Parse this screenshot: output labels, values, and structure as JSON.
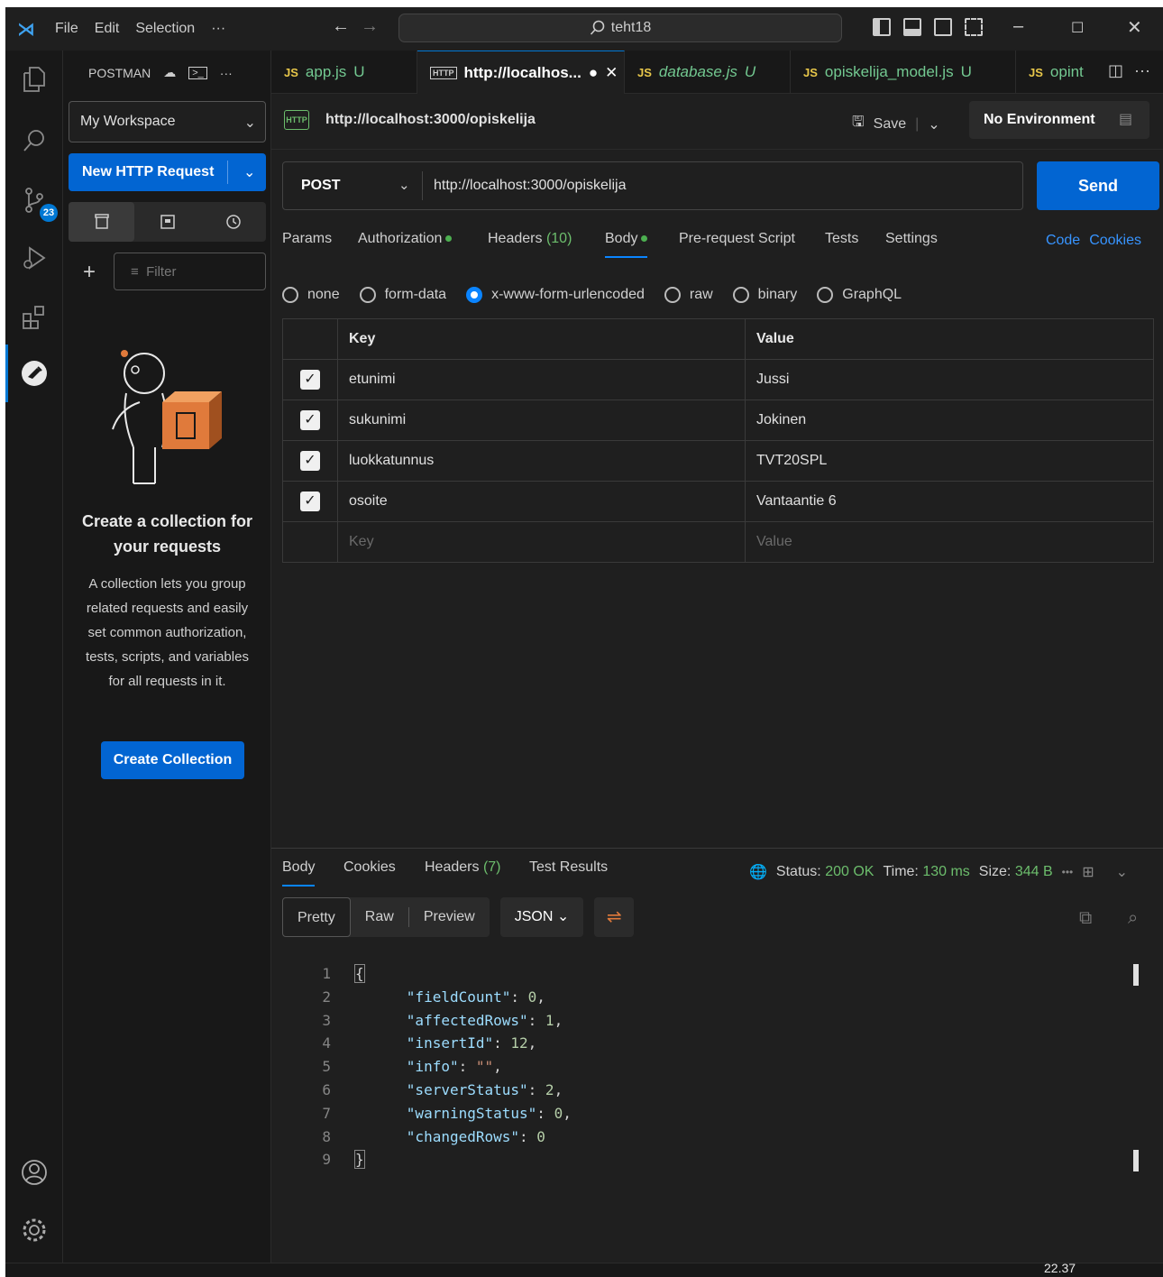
{
  "titlebar": {
    "menu": [
      "File",
      "Edit",
      "Selection",
      "···"
    ],
    "search_text": "teht18"
  },
  "activity": {
    "scm_badge": "23"
  },
  "sidebar": {
    "header": "POSTMAN",
    "workspace": "My Workspace",
    "new_request": "New HTTP Request",
    "filter_placeholder": "Filter",
    "empty_title": "Create a collection for your requests",
    "empty_desc": "A collection lets you group related requests and easily set common authorization, tests, scripts, and variables for all requests in it.",
    "create_button": "Create Collection"
  },
  "tabs": [
    {
      "icon": "JS",
      "label": "app.js",
      "status": "U"
    },
    {
      "icon": "HTTP",
      "label": "http://localhos...",
      "status": "●"
    },
    {
      "icon": "JS",
      "label": "database.js",
      "status": "U"
    },
    {
      "icon": "JS",
      "label": "opiskelija_model.js",
      "status": "U"
    },
    {
      "icon": "JS",
      "label": "opint",
      "status": ""
    }
  ],
  "request": {
    "title": "http://localhost:3000/opiskelija",
    "save": "Save",
    "environment": "No Environment",
    "method": "POST",
    "url": "http://localhost:3000/opiskelija",
    "send": "Send"
  },
  "request_tabs": {
    "params": "Params",
    "authorization": "Authorization",
    "headers": "Headers",
    "headers_count": "(10)",
    "body": "Body",
    "prerequest": "Pre-request Script",
    "tests": "Tests",
    "settings": "Settings",
    "code": "Code",
    "cookies": "Cookies"
  },
  "body_types": [
    "none",
    "form-data",
    "x-www-form-urlencoded",
    "raw",
    "binary",
    "GraphQL"
  ],
  "body_type_selected": "x-www-form-urlencoded",
  "kv": {
    "key_header": "Key",
    "value_header": "Value",
    "rows": [
      {
        "key": "etunimi",
        "value": "Jussi",
        "checked": true
      },
      {
        "key": "sukunimi",
        "value": "Jokinen",
        "checked": true
      },
      {
        "key": "luokkatunnus",
        "value": "TVT20SPL",
        "checked": true
      },
      {
        "key": "osoite",
        "value": "Vantaantie 6",
        "checked": true
      }
    ],
    "key_placeholder": "Key",
    "value_placeholder": "Value"
  },
  "response": {
    "tabs": {
      "body": "Body",
      "cookies": "Cookies",
      "headers": "Headers",
      "headers_count": "(7)",
      "tests": "Test Results"
    },
    "status_label": "Status:",
    "status": "200 OK",
    "time_label": "Time:",
    "time": "130 ms",
    "size_label": "Size:",
    "size": "344 B",
    "views": [
      "Pretty",
      "Raw",
      "Preview"
    ],
    "format": "JSON",
    "lines": [
      "1",
      "2",
      "3",
      "4",
      "5",
      "6",
      "7",
      "8",
      "9"
    ]
  },
  "statusbar": {
    "clock": "22.37"
  }
}
